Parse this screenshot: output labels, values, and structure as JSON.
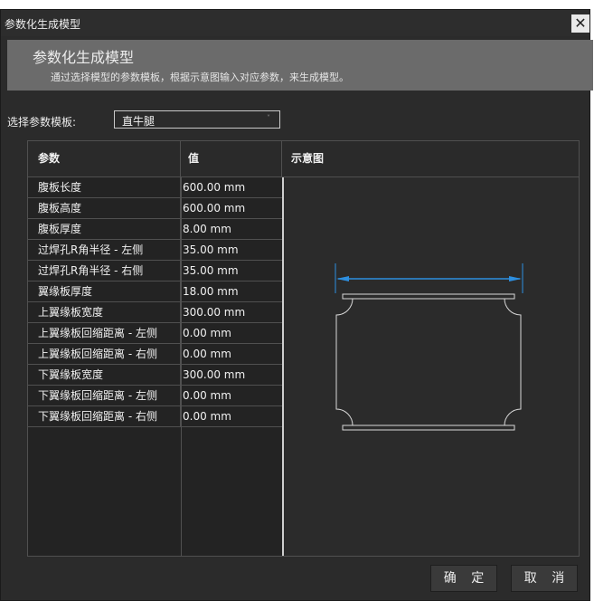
{
  "window": {
    "title": "参数化生成模型",
    "close_label": "✕"
  },
  "header": {
    "title": "参数化生成模型",
    "subtitle": "通过选择模型的参数模板，根据示意图输入对应参数，来生成模型。"
  },
  "template": {
    "label": "选择参数模板:",
    "value": "直牛腿",
    "chevron": "˅"
  },
  "grid": {
    "columns": {
      "param": "参数",
      "value": "值",
      "diagram": "示意图"
    },
    "rows": [
      {
        "name": "腹板长度",
        "value": "600.00 mm"
      },
      {
        "name": "腹板高度",
        "value": "600.00 mm"
      },
      {
        "name": "腹板厚度",
        "value": "8.00 mm"
      },
      {
        "name": "过焊孔R角半径 - 左侧",
        "value": "35.00 mm"
      },
      {
        "name": "过焊孔R角半径 - 右侧",
        "value": "35.00 mm"
      },
      {
        "name": "翼缘板厚度",
        "value": "18.00 mm"
      },
      {
        "name": "上翼缘板宽度",
        "value": "300.00 mm"
      },
      {
        "name": "上翼缘板回缩距离 - 左侧",
        "value": "0.00 mm"
      },
      {
        "name": "上翼缘板回缩距离 - 右侧",
        "value": "0.00 mm"
      },
      {
        "name": "下翼缘板宽度",
        "value": "300.00 mm"
      },
      {
        "name": "下翼缘板回缩距离 - 左侧",
        "value": "0.00 mm"
      },
      {
        "name": "下翼缘板回缩距离 - 右侧",
        "value": "0.00 mm"
      }
    ]
  },
  "colors": {
    "dimension": "#2d8fe0",
    "outline": "#d8d8d8"
  },
  "buttons": {
    "ok": "确 定",
    "cancel": "取 消"
  }
}
